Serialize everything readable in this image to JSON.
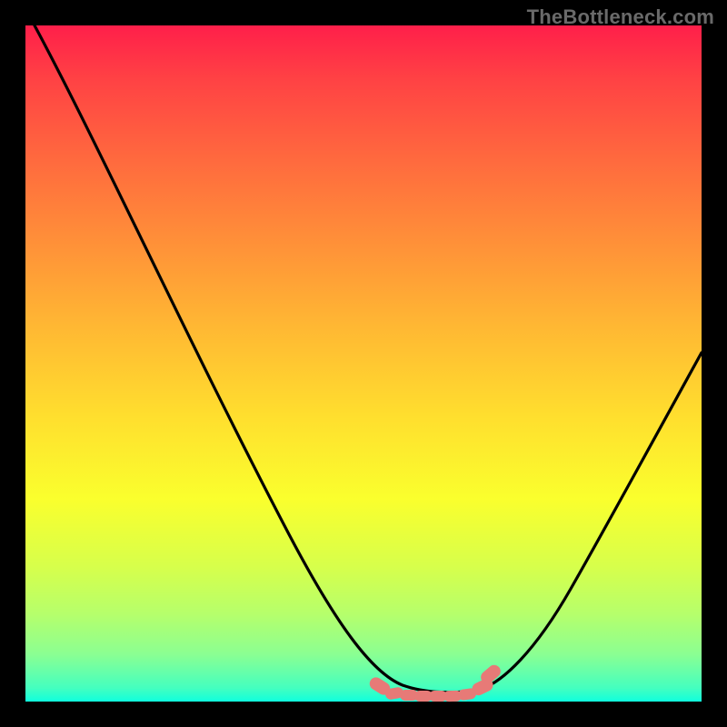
{
  "watermark": "TheBottleneck.com",
  "chart_data": {
    "type": "line",
    "title": "",
    "xlabel": "",
    "ylabel": "",
    "xlim": [
      0,
      100
    ],
    "ylim": [
      0,
      100
    ],
    "grid": false,
    "series": [
      {
        "name": "curve",
        "x": [
          0,
          5,
          10,
          15,
          20,
          25,
          30,
          35,
          40,
          45,
          50,
          52,
          55,
          58,
          62,
          65,
          68,
          72,
          75,
          78,
          82,
          86,
          90,
          95,
          100
        ],
        "y": [
          100,
          90,
          80,
          70,
          60,
          50,
          41,
          32,
          23,
          15,
          8,
          5,
          3,
          2,
          2,
          2,
          2,
          3,
          5,
          8,
          13,
          20,
          28,
          39,
          52
        ]
      }
    ],
    "markers": {
      "name": "highlight-zone",
      "x_start": 52,
      "x_end": 68,
      "color": "#e77a77"
    },
    "background_gradient": {
      "top": "#ff1f4a",
      "mid": "#ffdf2e",
      "bottom": "#0fffde"
    }
  }
}
